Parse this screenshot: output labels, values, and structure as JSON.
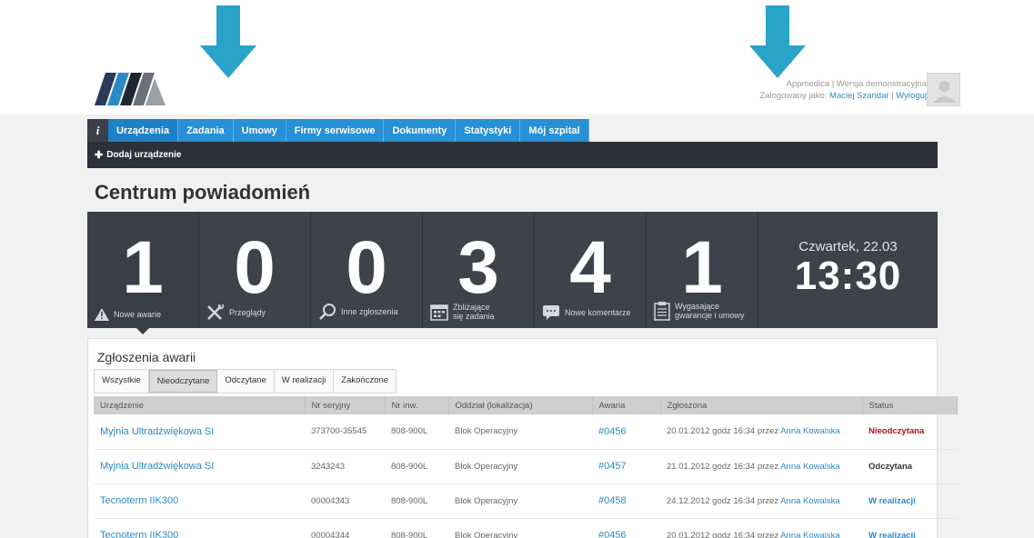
{
  "colors": {
    "accent": "#2790d6",
    "dark": "#3e424b",
    "arrow": "#2aa3c8",
    "status_unread": "#b0121a"
  },
  "header": {
    "app_line": "Appmedica | Wersja demonstracyjna",
    "logged_prefix": "Zalogowany jako:",
    "user_name": "Maciej Szandar",
    "separator": "|",
    "logout": "Wyloguj"
  },
  "nav": {
    "info_label": "i",
    "tabs": [
      "Urządzenia",
      "Zadania",
      "Umowy",
      "Firmy serwisowe",
      "Dokumenty",
      "Statystyki",
      "Mój szpital"
    ]
  },
  "subbar": {
    "add_device": "Dodaj urządzenie"
  },
  "page_title": "Centrum powiadomień",
  "tiles": [
    {
      "count": "1",
      "label": "Nowe awarie",
      "icon": "warning-icon"
    },
    {
      "count": "0",
      "label": "Przeglądy",
      "icon": "tools-icon"
    },
    {
      "count": "0",
      "label": "Inne zgłoszenia",
      "icon": "search-icon"
    },
    {
      "count": "3",
      "label_line1": "Zbliżające",
      "label_line2": "się zadania",
      "icon": "calendar-icon"
    },
    {
      "count": "4",
      "label": "Nowe komentarze",
      "icon": "comment-icon"
    },
    {
      "count": "1",
      "label_line1": "Wygasające",
      "label_line2": "gwarancje i umowy",
      "icon": "clipboard-icon"
    }
  ],
  "clock": {
    "day": "Czwartek, 22.03",
    "time": "13:30"
  },
  "panel": {
    "title": "Zgłoszenia awarii",
    "filters": [
      "Wszystkie",
      "Nieodczytane",
      "Odczytane",
      "W realizacji",
      "Zakończone"
    ],
    "selected_filter": "Nieodczytane",
    "columns": [
      "Urządzenie",
      "Nr seryjny",
      "Nr inw.",
      "Oddział (lokalizacja)",
      "Awaria",
      "Zgłoszona",
      "Status"
    ],
    "rows": [
      {
        "device": "Myjnia Ultradźwiękowa SI",
        "serial": "373700-35545",
        "inv": "808-900L",
        "dept": "Blok Operacyjny",
        "issue": "#0456",
        "reported": "20.01.2012 godz 16:34 przez",
        "person": "Anna Kowalska",
        "status": "Nieodczytana",
        "status_type": "red"
      },
      {
        "device": "Myjnia Ultradźwiękowa SI",
        "serial": "3243243",
        "inv": "808-900L",
        "dept": "Blok Operacyjny",
        "issue": "#0457",
        "reported": "21.01.2012 godz 16:34 przez",
        "person": "Anna Kowalska",
        "status": "Odczytana",
        "status_type": "dark"
      },
      {
        "device": "Tecnoterm IIK300",
        "serial": "00004343",
        "inv": "808-900L",
        "dept": "Blok Operacyjny",
        "issue": "#0458",
        "reported": "24.12.2012 godz 16:34 przez",
        "person": "Anna Kowalska",
        "status": "W realizacji",
        "status_type": "blue"
      },
      {
        "device": "Tecnoterm IIK300",
        "serial": "00004344",
        "inv": "808-900L",
        "dept": "Blok Operacyjny",
        "issue": "#0456",
        "reported": "20.01.2012 godz 16:34 przez",
        "person": "Anna Kowalska",
        "status": "W realizacji",
        "status_type": "blue"
      }
    ]
  }
}
